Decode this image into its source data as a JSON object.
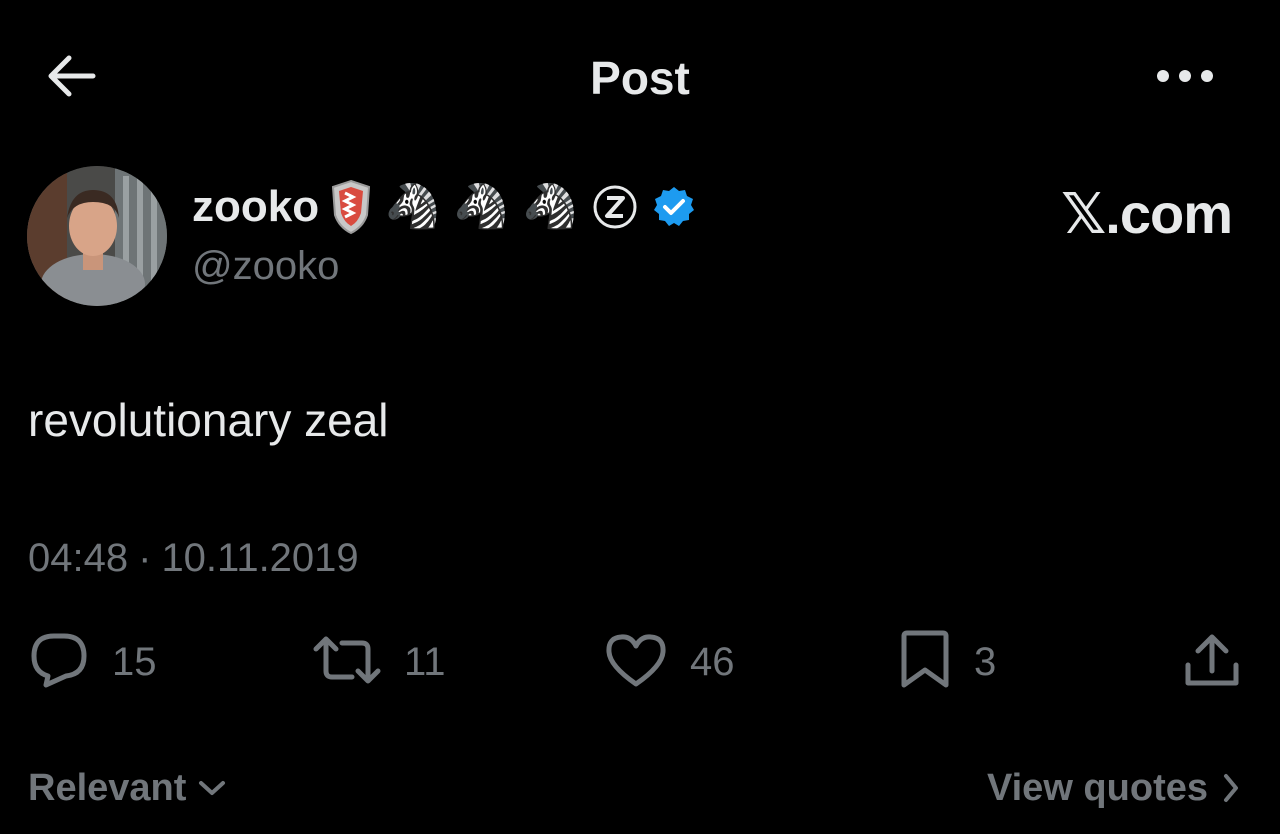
{
  "header": {
    "title": "Post",
    "back_icon": "arrow-left-icon",
    "more_icon": "more-horizontal-icon"
  },
  "author": {
    "display_name": "zooko",
    "handle": "@zooko",
    "badges": [
      "shield-icon",
      "zebra",
      "zebra",
      "zebra",
      "z-circle-icon",
      "verified-icon"
    ],
    "zebra_emoji": "🦓",
    "verified_color": "#1d9bf0"
  },
  "watermark": {
    "text": "𝕏.com"
  },
  "post": {
    "text": "revolutionary zeal",
    "time": "04:48",
    "separator": "·",
    "date": "10.11.2019"
  },
  "actions": {
    "replies": "15",
    "reposts": "11",
    "likes": "46",
    "bookmarks": "3",
    "icons": [
      "reply-icon",
      "repost-icon",
      "like-icon",
      "bookmark-icon",
      "share-icon"
    ]
  },
  "footer": {
    "sort_label": "Relevant",
    "quotes_label": "View quotes"
  },
  "colors": {
    "background": "#000000",
    "text_primary": "#e7e9ea",
    "text_secondary": "#71767b"
  }
}
